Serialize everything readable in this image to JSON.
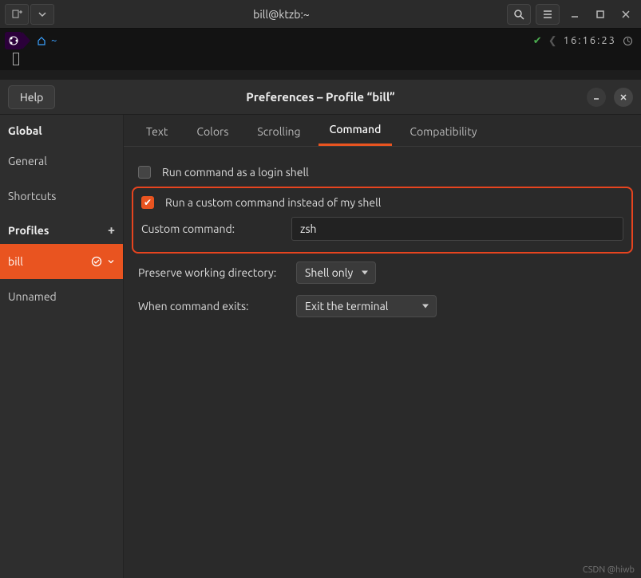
{
  "window": {
    "title": "bill@ktzb:~",
    "time": "16:16:23"
  },
  "prompt": {
    "path": "~"
  },
  "prefs": {
    "help_label": "Help",
    "title": "Preferences – Profile “bill”",
    "sidebar": {
      "global_header": "Global",
      "general": "General",
      "shortcuts": "Shortcuts",
      "profiles_header": "Profiles",
      "profiles": [
        {
          "name": "bill",
          "active": true
        },
        {
          "name": "Unnamed",
          "active": false
        }
      ]
    },
    "tabs": {
      "text": "Text",
      "colors": "Colors",
      "scrolling": "Scrolling",
      "command": "Command",
      "compatibility": "Compatibility",
      "active": "command"
    },
    "command_panel": {
      "login_shell_label": "Run command as a login shell",
      "login_shell_checked": false,
      "custom_cmd_label": "Run a custom command instead of my shell",
      "custom_cmd_checked": true,
      "custom_cmd_field_label": "Custom command:",
      "custom_cmd_value": "zsh",
      "preserve_label": "Preserve working directory:",
      "preserve_value": "Shell only",
      "exit_label": "When command exits:",
      "exit_value": "Exit the terminal"
    }
  },
  "watermark": "CSDN @hiwb"
}
